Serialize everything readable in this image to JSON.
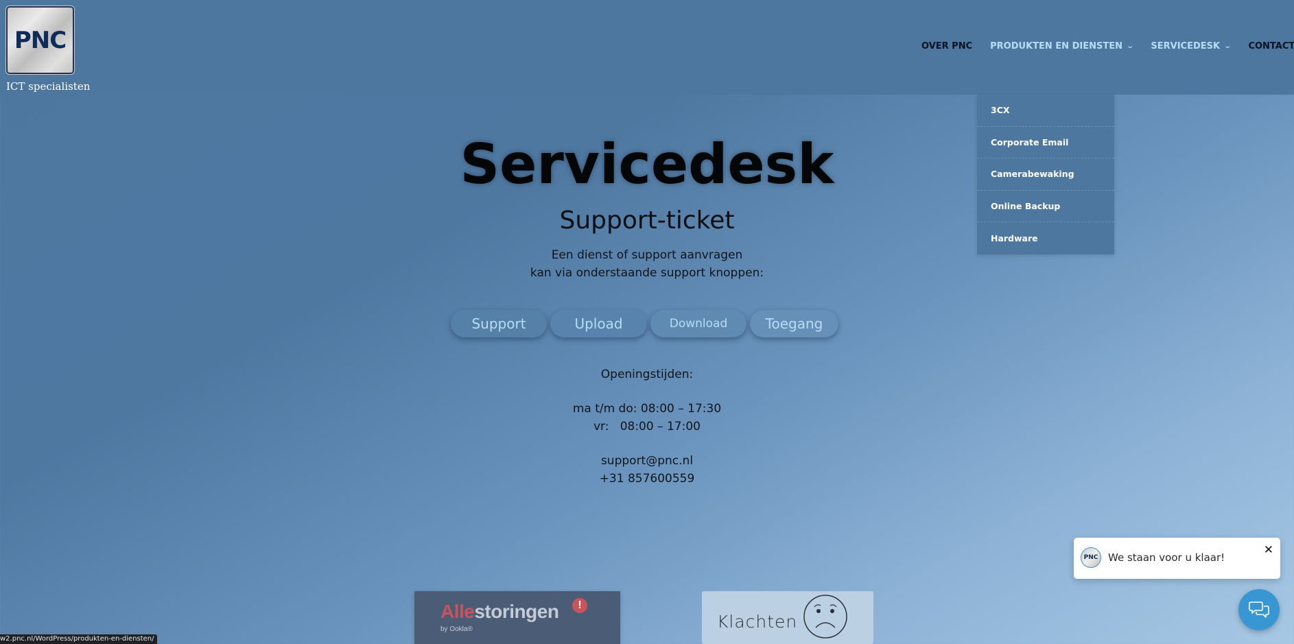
{
  "brand": {
    "logo_text": "PNC",
    "tagline": "ICT specialisten"
  },
  "nav": {
    "items": [
      {
        "label": "OVER PNC",
        "has_dropdown": false,
        "active": false
      },
      {
        "label": "PRODUKTEN EN DIENSTEN",
        "has_dropdown": true,
        "active": true
      },
      {
        "label": "SERVICEDESK",
        "has_dropdown": true,
        "active": true
      },
      {
        "label": "CONTACT",
        "has_dropdown": false,
        "active": false
      }
    ],
    "chevron_icon": "⌄"
  },
  "dropdown": {
    "parent": "PRODUKTEN EN DIENSTEN",
    "items": [
      "3CX",
      "Corporate Email",
      "Camerabewaking",
      "Online Backup",
      "Hardware"
    ]
  },
  "hero": {
    "title": "Servicedesk",
    "subtitle": "Support-ticket",
    "intro_line1": "Een dienst of support aanvragen",
    "intro_line2": "kan via onderstaande support knoppen:"
  },
  "buttons": [
    "Support",
    "Upload",
    "Download",
    "Toegang"
  ],
  "contact": {
    "hours_label": "Openingstijden:",
    "hours_mon_thu": "ma t/m do: 08:00 – 17:30",
    "hours_fri": "vr:   08:00 – 17:00",
    "email": "support@pnc.nl",
    "phone": "+31 857600559"
  },
  "banners": {
    "allestoringen": {
      "red": "Alle",
      "grey": "storingen",
      "badge": "!",
      "by": "by Ookla®"
    },
    "klachten": {
      "label": "Klachten"
    }
  },
  "chat": {
    "avatar_text": "PNC",
    "message": "We staan voor u klaar!",
    "close_icon": "✕"
  },
  "status_bar": {
    "url": "w2.pnc.nl/WordPress/produkten-en-diensten/"
  },
  "colors": {
    "header_bg": "#4e77a0",
    "nav_active": "#b8dcf4",
    "button_bg": "#5580a8",
    "button_text": "#b9dcf5",
    "chat_accent": "#3897d3"
  }
}
